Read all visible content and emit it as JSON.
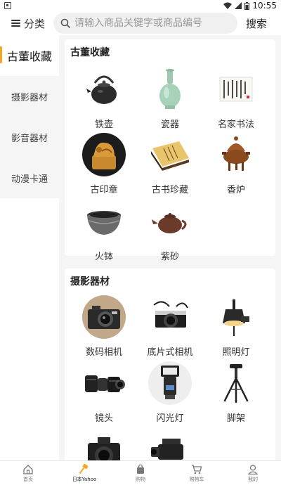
{
  "status": {
    "time": "10:55"
  },
  "header": {
    "category_label": "分类",
    "search_placeholder": "请输入商品关键字或商品编号",
    "search_button": "搜索"
  },
  "sidebar": {
    "items": [
      {
        "label": "古董收藏",
        "active": true
      },
      {
        "label": "摄影器材",
        "active": false
      },
      {
        "label": "影音器材",
        "active": false
      },
      {
        "label": "动漫卡通",
        "active": false
      }
    ]
  },
  "sections": [
    {
      "title": "古董收藏",
      "items": [
        {
          "label": "铁壶",
          "icon": "iron-teapot-image"
        },
        {
          "label": "瓷器",
          "icon": "celadon-vase-image"
        },
        {
          "label": "名家书法",
          "icon": "calligraphy-image"
        },
        {
          "label": "古印章",
          "icon": "ancient-seal-image"
        },
        {
          "label": "古书珍藏",
          "icon": "ancient-book-image"
        },
        {
          "label": "香炉",
          "icon": "incense-burner-image"
        },
        {
          "label": "火钵",
          "icon": "fire-bowl-image"
        },
        {
          "label": "紫砂",
          "icon": "zisha-teapot-image"
        }
      ]
    },
    {
      "title": "摄影器材",
      "items": [
        {
          "label": "数码相机",
          "icon": "digital-camera-image"
        },
        {
          "label": "底片式相机",
          "icon": "film-camera-image"
        },
        {
          "label": "照明灯",
          "icon": "studio-light-image"
        },
        {
          "label": "镜头",
          "icon": "camera-lens-image"
        },
        {
          "label": "闪光灯",
          "icon": "flash-unit-image"
        },
        {
          "label": "脚架",
          "icon": "tripod-image"
        },
        {
          "label": "",
          "icon": "dslr-camera-image"
        },
        {
          "label": "",
          "icon": "video-camera-image"
        }
      ]
    }
  ],
  "bottom_nav": [
    {
      "label": "首页",
      "icon": "home-icon",
      "active": false
    },
    {
      "label": "日本Yahoo",
      "icon": "auction-hammer-icon",
      "active": true
    },
    {
      "label": "购物",
      "icon": "shopping-bag-icon",
      "active": false
    },
    {
      "label": "购物车",
      "icon": "cart-icon",
      "active": false
    },
    {
      "label": "我的",
      "icon": "user-icon",
      "active": false
    }
  ],
  "colors": {
    "accent": "#f5a623",
    "background": "#f5f5f5"
  }
}
